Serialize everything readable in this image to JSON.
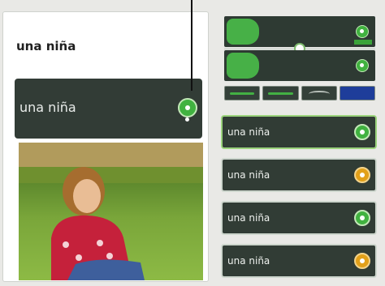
{
  "lesson": {
    "prompt": "una niña",
    "answer": "una niña"
  },
  "choices": [
    {
      "label": "una niña",
      "selected": true
    },
    {
      "label": "una niña",
      "selected": false
    },
    {
      "label": "una niña",
      "selected": false
    },
    {
      "label": "una niña",
      "selected": false
    }
  ],
  "colors": {
    "panel_dark": "#313c35",
    "accent_green": "#41b240",
    "highlight_blue": "#1e3d9a"
  },
  "icons": {
    "audio": "speaker-icon",
    "waveform": "waveform-icon"
  }
}
